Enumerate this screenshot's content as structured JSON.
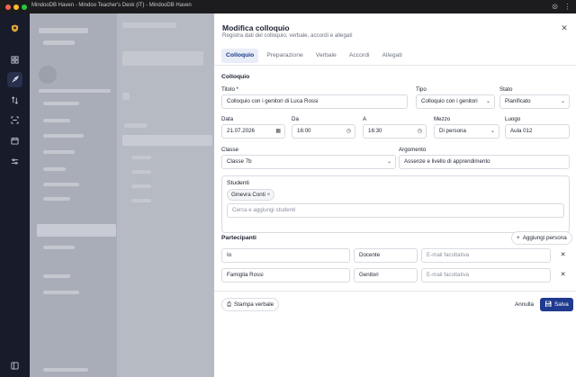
{
  "window": {
    "title": "MindooDB Haven - Mindoo Teacher's Desk (IT) - MindooDB Haven"
  },
  "panel": {
    "title": "Modifica colloquio",
    "subtitle": "Registra dati del colloquio, verbale, accordi e allegati",
    "tabs": [
      "Colloquio",
      "Preparazione",
      "Verbale",
      "Accordi",
      "Allegati"
    ],
    "section_title": "Colloquio",
    "fields": {
      "titolo_label": "Titolo *",
      "titolo_value": "Colloquio con i genitori di Luca Rossi",
      "tipo_label": "Tipo",
      "tipo_value": "Colloquio con i genitori",
      "stato_label": "Stato",
      "stato_value": "Pianificato",
      "data_label": "Data",
      "data_value": "21.07.2026",
      "da_label": "Da",
      "da_value": "16:00",
      "a_label": "A",
      "a_value": "16:30",
      "mezzo_label": "Mezzo",
      "mezzo_value": "Di persona",
      "luogo_label": "Luogo",
      "luogo_value": "Aula 012",
      "classe_label": "Classe",
      "classe_value": "Classe 7b",
      "argomento_label": "Argomento",
      "argomento_value": "Assenze e livello di apprendimento"
    },
    "studenti": {
      "label": "Studenti",
      "chips": [
        "Ginevra Conti"
      ],
      "placeholder": "Cerca e aggiungi studenti"
    },
    "partecipanti": {
      "label": "Partecipanti",
      "add_label": "Aggiungi persona",
      "rows": [
        {
          "name": "Io",
          "role": "Docente",
          "email_placeholder": "E-mail facoltativa"
        },
        {
          "name": "Famiglia Rossi",
          "role": "Genitori",
          "email_placeholder": "E-mail facoltativa"
        }
      ]
    },
    "footer": {
      "print_label": "Stampa verbale",
      "cancel_label": "Annulla",
      "save_label": "Salva"
    }
  },
  "colors": {
    "accent": "#1f3a8f",
    "tab_active_bg": "#e8edf8",
    "rail_bg": "#171b2a"
  }
}
